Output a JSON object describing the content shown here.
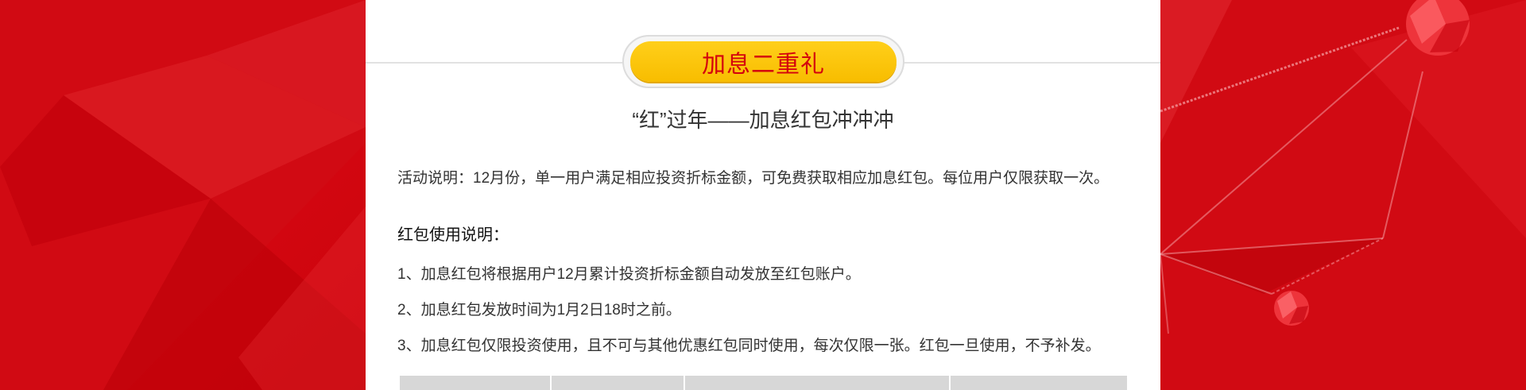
{
  "badge": {
    "label": "加息二重礼"
  },
  "subtitle": "“红”过年——加息红包冲冲冲",
  "intro": "活动说明：12月份，单一用户满足相应投资折标金额，可免费获取相应加息红包。每位用户仅限获取一次。",
  "rules": {
    "title": "红包使用说明：",
    "items": [
      "1、加息红包将根据用户12月累计投资折标金额自动发放至红包账户。",
      "2、加息红包发放时间为1月2日18时之前。",
      "3、加息红包仅限投资使用，且不可与其他优惠红包同时使用，每次仅限一张。红包一旦使用，不予补发。"
    ]
  },
  "colors": {
    "background_red": "#c8000a",
    "badge_yellow": "#f8bd00",
    "badge_text_red": "#d4000d",
    "panel_white": "#ffffff",
    "table_header_gray": "#d7d7d7"
  },
  "decorations": [
    "red-polygon-background",
    "red-gem-ball-icon",
    "red-gem-ball-icon"
  ]
}
